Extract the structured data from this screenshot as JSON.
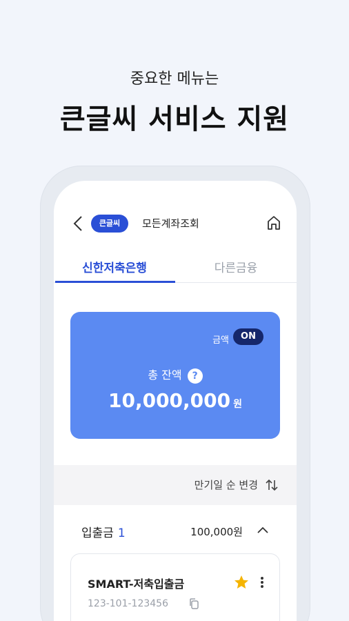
{
  "headline": {
    "sub": "중요한 메뉴는",
    "main": "큰글씨 서비스 지원"
  },
  "topbar": {
    "badge": "큰글씨",
    "title": "모든계좌조회"
  },
  "tabs": [
    {
      "label": "신한저축은행",
      "active": true
    },
    {
      "label": "다른금융",
      "active": false
    }
  ],
  "balance_card": {
    "toggle_label": "금액",
    "toggle_state": "ON",
    "total_label": "총 잔액",
    "help_icon": "?",
    "amount": "10,000,000",
    "unit": "원"
  },
  "sort": {
    "label": "만기일 순 변경"
  },
  "section": {
    "title": "입출금",
    "count": "1",
    "total": "100,000원"
  },
  "account": {
    "name": "SMART-저축입출금",
    "number": "123-101-123456"
  },
  "colors": {
    "accent": "#2a4fd6",
    "card": "#5b8af2",
    "toggle": "#15276b",
    "star": "#f5b400"
  }
}
